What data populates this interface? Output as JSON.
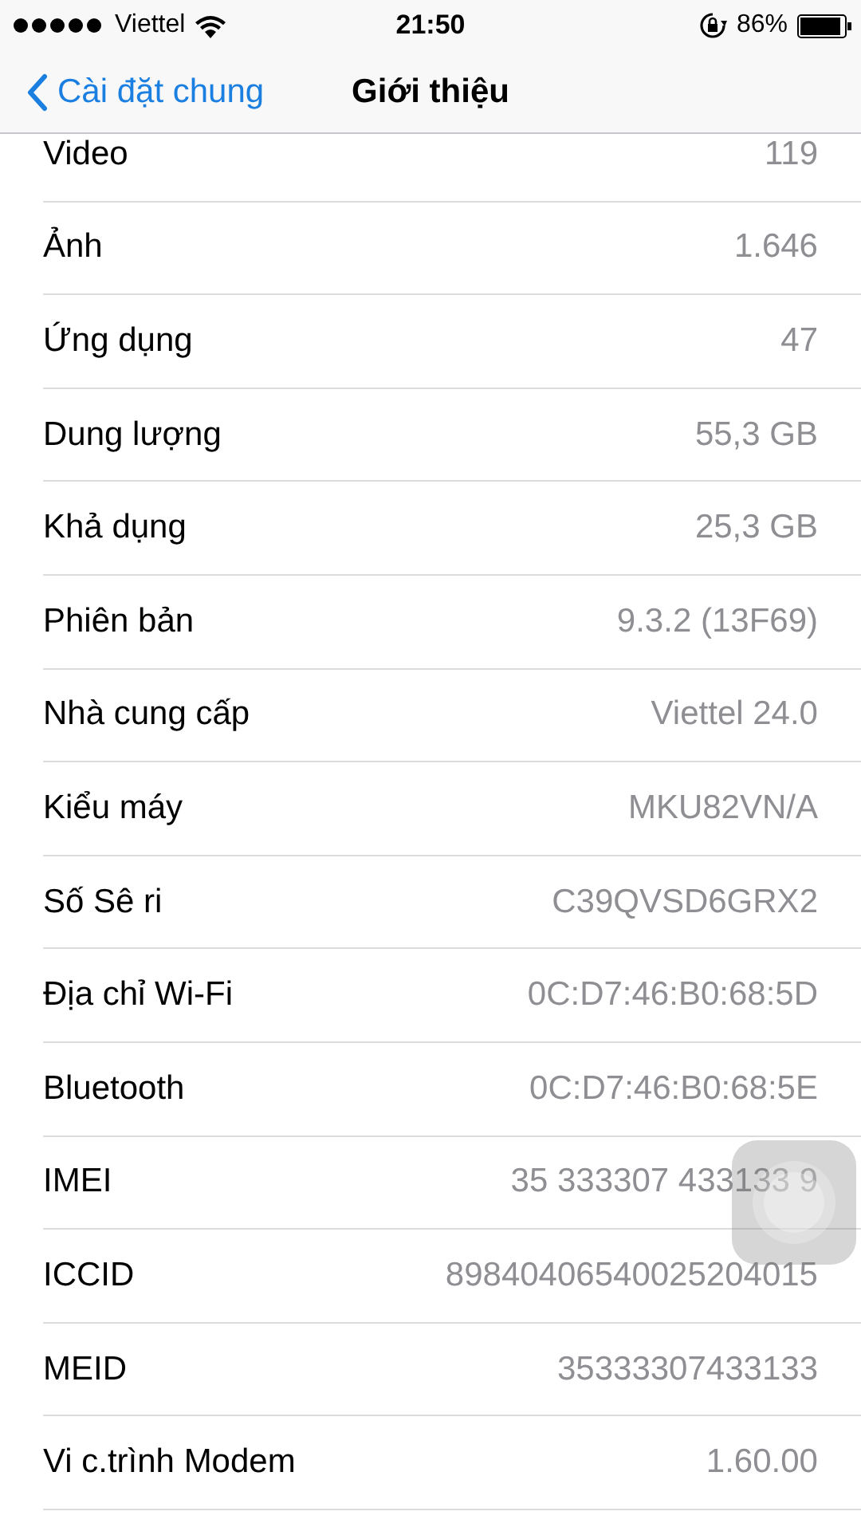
{
  "status_bar": {
    "carrier": "Viettel",
    "time": "21:50",
    "battery": "86%"
  },
  "nav": {
    "back": "Cài đặt chung",
    "title": "Giới thiệu"
  },
  "rows": [
    {
      "label": "Video",
      "value": "119"
    },
    {
      "label": "Ảnh",
      "value": "1.646"
    },
    {
      "label": "Ứng dụng",
      "value": "47"
    },
    {
      "label": "Dung lượng",
      "value": "55,3 GB"
    },
    {
      "label": "Khả dụng",
      "value": "25,3 GB"
    },
    {
      "label": "Phiên bản",
      "value": "9.3.2 (13F69)"
    },
    {
      "label": "Nhà cung cấp",
      "value": "Viettel 24.0"
    },
    {
      "label": "Kiểu máy",
      "value": "MKU82VN/A"
    },
    {
      "label": "Số Sê ri",
      "value": "C39QVSD6GRX2"
    },
    {
      "label": "Địa chỉ Wi-Fi",
      "value": "0C:D7:46:B0:68:5D"
    },
    {
      "label": "Bluetooth",
      "value": "0C:D7:46:B0:68:5E"
    },
    {
      "label": "IMEI",
      "value": "35 333307 433133 9"
    },
    {
      "label": "ICCID",
      "value": "89840406540025204015"
    },
    {
      "label": "MEID",
      "value": "35333307433133"
    },
    {
      "label": "Vi c.trình Modem",
      "value": "1.60.00"
    }
  ]
}
